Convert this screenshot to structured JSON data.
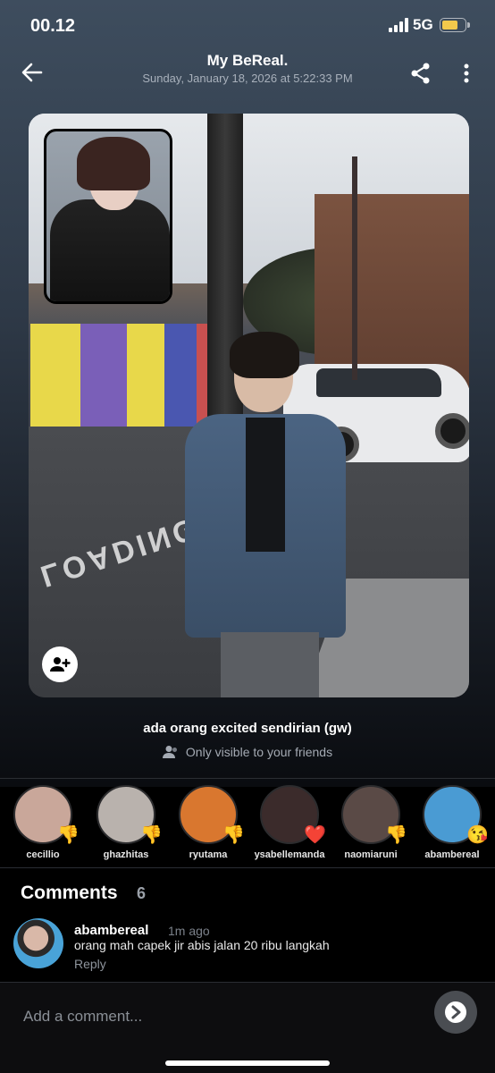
{
  "status_bar": {
    "time": "00.12",
    "network": "5G"
  },
  "header": {
    "title": "My BeReal.",
    "subtitle": "Sunday, January 18, 2026 at 5:22:33 PM"
  },
  "post": {
    "road_text": "LOADING",
    "caption": "ada orang excited sendirian (gw)",
    "visibility": "Only visible to your friends"
  },
  "reactions": [
    {
      "name": "cecillio",
      "emoji": "👎",
      "avatar_bg": "#c9a79a"
    },
    {
      "name": "ghazhitas",
      "emoji": "👎",
      "avatar_bg": "#b9b2ad"
    },
    {
      "name": "ryutama",
      "emoji": "👎",
      "avatar_bg": "#d9772f"
    },
    {
      "name": "ysabellemanda",
      "emoji": "❤️",
      "avatar_bg": "#3b2b2b"
    },
    {
      "name": "naomiaruni",
      "emoji": "👎",
      "avatar_bg": "#5a4a46"
    },
    {
      "name": "abambereal",
      "emoji": "😘",
      "avatar_bg": "#4a9bd3"
    }
  ],
  "comments_section": {
    "title": "Comments",
    "count": "6",
    "items": [
      {
        "user": "abambereal",
        "time": "1m ago",
        "text": "orang mah capek jir abis jalan 20 ribu langkah",
        "reply_label": "Reply"
      }
    ],
    "input_placeholder": "Add a comment..."
  },
  "colors": {
    "accent": "#ffffff",
    "battery": "#f2c94c",
    "background": "#000000"
  }
}
